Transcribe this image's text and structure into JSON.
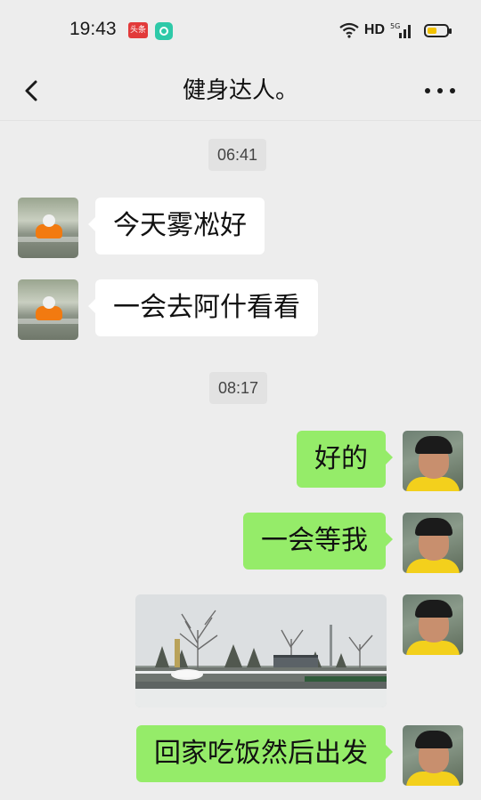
{
  "status_bar": {
    "time": "19:43",
    "app_badge_label": "头条",
    "network_label": "HD",
    "signal_label": "5G",
    "battery_color": "#f2c200"
  },
  "header": {
    "title": "健身达人。",
    "back_icon": "chevron-left-icon",
    "more_icon": "more-dots-icon"
  },
  "messages": [
    {
      "type": "timestamp",
      "text": "06:41"
    },
    {
      "type": "text",
      "side": "left",
      "text": "今天雾凇好"
    },
    {
      "type": "text",
      "side": "left",
      "text": "一会去阿什看看"
    },
    {
      "type": "timestamp",
      "text": "08:17"
    },
    {
      "type": "text",
      "side": "right",
      "text": "好的"
    },
    {
      "type": "text",
      "side": "right",
      "text": "一会等我"
    },
    {
      "type": "image",
      "side": "right",
      "subject": "snowy street scene with bare frosted trees"
    },
    {
      "type": "text",
      "side": "right",
      "text": "回家吃饭然后出发"
    }
  ],
  "colors": {
    "background": "#ededed",
    "bubble_sent": "#95ec69",
    "bubble_received": "#ffffff"
  }
}
